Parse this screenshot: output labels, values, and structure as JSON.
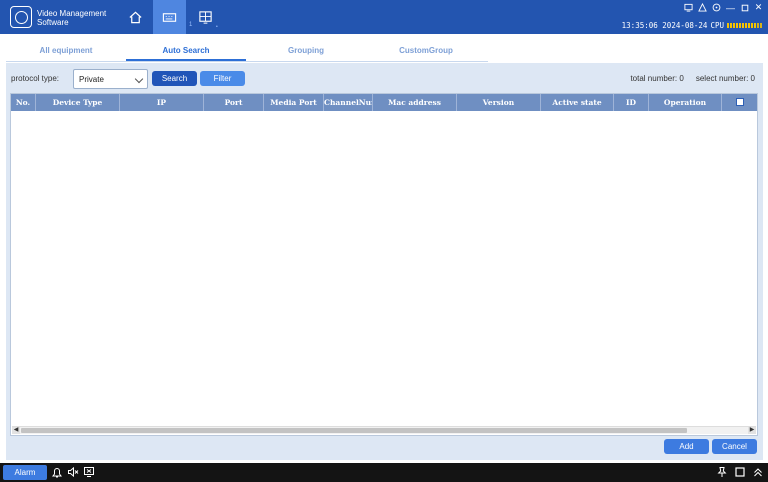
{
  "app": {
    "title_line1": "Video Management",
    "title_line2": "Software"
  },
  "titlebar": {
    "nav": [
      {
        "name": "home-icon"
      },
      {
        "name": "device-keyboard-icon",
        "active": true
      },
      {
        "name": "monitor-grid-icon"
      }
    ],
    "nav_sub": "1",
    "datetime": "13:35:06 2024-08-24",
    "cpu_label": "CPU",
    "window_controls": [
      "monitor-icon",
      "user-icon",
      "help-icon",
      "minimize-icon",
      "maximize-icon",
      "close-icon"
    ]
  },
  "tabs": [
    {
      "label": "All equipment",
      "active": false
    },
    {
      "label": "Auto Search",
      "active": true
    },
    {
      "label": "Grouping",
      "active": false
    },
    {
      "label": "CustomGroup",
      "active": false
    }
  ],
  "toolbar": {
    "protocol_label": "protocol type:",
    "protocol_value": "Private",
    "search_label": "Search",
    "filter_label": "Filter",
    "total_label": "total number:",
    "total_value": "0",
    "select_label": "select number:",
    "select_value": "0"
  },
  "table": {
    "columns": [
      "No.",
      "Device Type",
      "IP",
      "Port",
      "Media Port",
      "ChannelNum",
      "Mac address",
      "Version",
      "Active state",
      "ID",
      "Operation"
    ],
    "rows": []
  },
  "footer": {
    "add_label": "Add",
    "cancel_label": "Cancel"
  },
  "bottombar": {
    "alarm_label": "Alarm"
  },
  "colors": {
    "titlebar": "#2355b0",
    "accent": "#3d7be0",
    "table_header": "#6f8fc2",
    "panel": "#dde7f4"
  }
}
